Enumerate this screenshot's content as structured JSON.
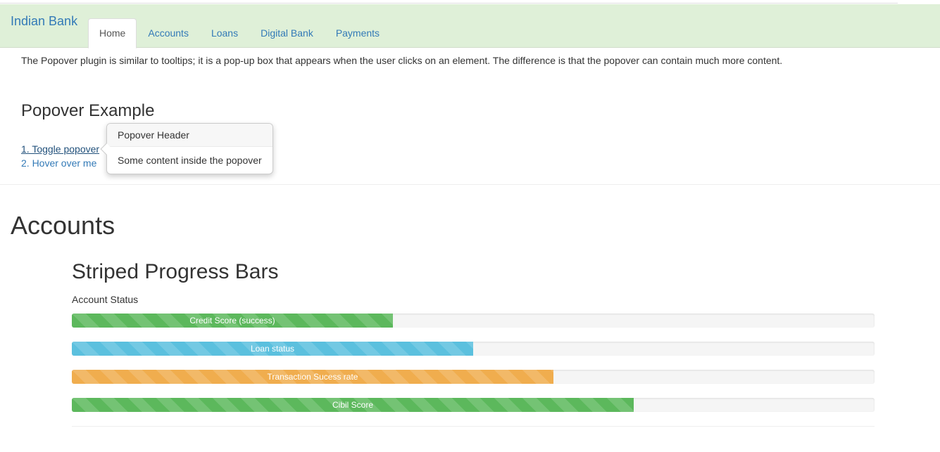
{
  "navbar": {
    "brand": "Indian Bank",
    "tabs": [
      {
        "label": "Home",
        "active": true
      },
      {
        "label": "Accounts",
        "active": false
      },
      {
        "label": "Loans",
        "active": false
      },
      {
        "label": "Digital Bank",
        "active": false
      },
      {
        "label": "Payments",
        "active": false
      }
    ]
  },
  "intro": "The Popover plugin is similar to tooltips; it is a pop-up box that appears when the user clicks on an element. The difference is that the popover can contain much more content.",
  "popover_section": {
    "heading": "Popover Example",
    "toggle_link": "1. Toggle popover",
    "hover_link": "2. Hover over me",
    "popover": {
      "title": "Popover Header",
      "content": "Some content inside the popover"
    }
  },
  "accounts": {
    "heading": "Accounts",
    "subheading": "Striped Progress Bars",
    "status_label": "Account Status",
    "bars": [
      {
        "label": "Credit Score (success)",
        "percent": 40,
        "color": "#5cb85c"
      },
      {
        "label": "Loan status",
        "percent": 50,
        "color": "#5bc0de"
      },
      {
        "label": "Transaction Sucess rate",
        "percent": 60,
        "color": "#f0ad4e"
      },
      {
        "label": "Cibil Score",
        "percent": 70,
        "color": "#5cb85c"
      }
    ]
  },
  "colors": {
    "navbar_bg": "#dff0d8",
    "link": "#337ab7"
  }
}
